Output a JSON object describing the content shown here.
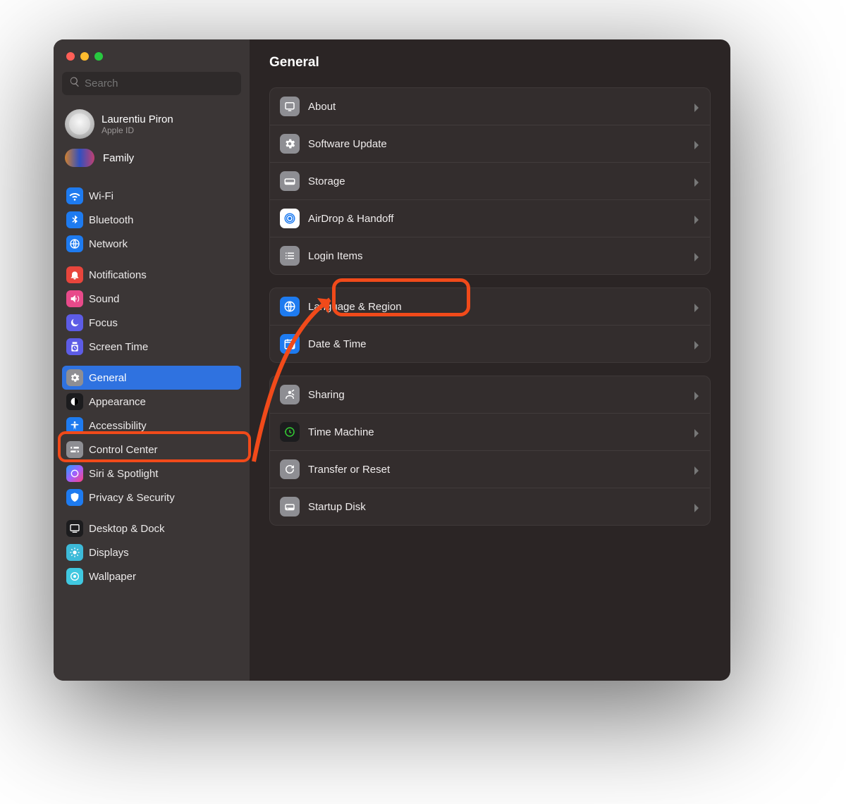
{
  "header": {
    "title": "General"
  },
  "search": {
    "placeholder": "Search"
  },
  "account": {
    "name": "Laurentiu Piron",
    "sub": "Apple ID",
    "family": "Family"
  },
  "sidebar": {
    "g1": [
      {
        "label": "Wi-Fi"
      },
      {
        "label": "Bluetooth"
      },
      {
        "label": "Network"
      }
    ],
    "g2": [
      {
        "label": "Notifications"
      },
      {
        "label": "Sound"
      },
      {
        "label": "Focus"
      },
      {
        "label": "Screen Time"
      }
    ],
    "g3": [
      {
        "label": "General"
      },
      {
        "label": "Appearance"
      },
      {
        "label": "Accessibility"
      },
      {
        "label": "Control Center"
      },
      {
        "label": "Siri & Spotlight"
      },
      {
        "label": "Privacy & Security"
      }
    ],
    "g4": [
      {
        "label": "Desktop & Dock"
      },
      {
        "label": "Displays"
      },
      {
        "label": "Wallpaper"
      }
    ]
  },
  "panels": [
    [
      {
        "label": "About"
      },
      {
        "label": "Software Update"
      },
      {
        "label": "Storage"
      },
      {
        "label": "AirDrop & Handoff"
      },
      {
        "label": "Login Items"
      }
    ],
    [
      {
        "label": "Language & Region"
      },
      {
        "label": "Date & Time"
      }
    ],
    [
      {
        "label": "Sharing"
      },
      {
        "label": "Time Machine"
      },
      {
        "label": "Transfer or Reset"
      },
      {
        "label": "Startup Disk"
      }
    ]
  ],
  "highlight_color": "#f14a1a"
}
